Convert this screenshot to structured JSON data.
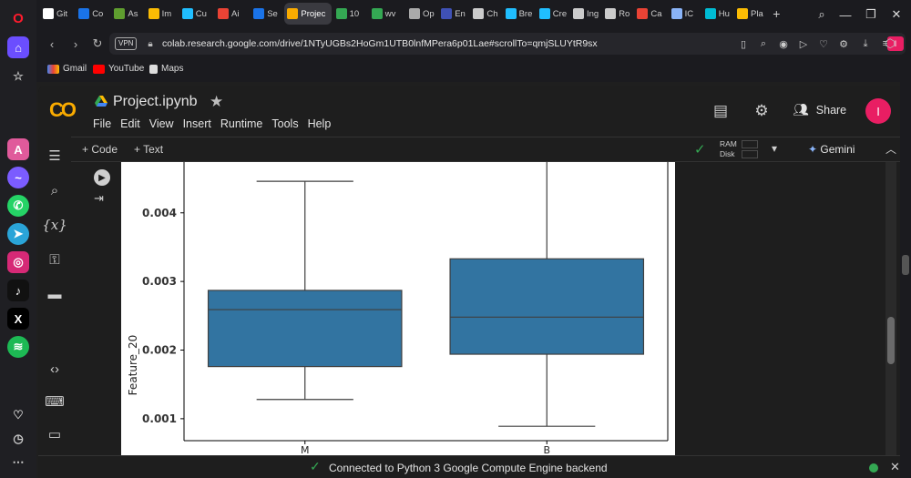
{
  "browser": {
    "tabs": [
      {
        "label": "Git",
        "icon": "github-icon",
        "color": "#ffffff"
      },
      {
        "label": "Co",
        "icon": "colab-icon",
        "color": "#1a73e8"
      },
      {
        "label": "As",
        "icon": "image-icon",
        "color": "#5f9e2f"
      },
      {
        "label": "Im",
        "icon": "drive-icon",
        "color": "#fbbc04"
      },
      {
        "label": "Cu",
        "icon": "kaggle-icon",
        "color": "#20beff"
      },
      {
        "label": "Ai",
        "icon": "gmail-icon",
        "color": "#ea4335"
      },
      {
        "label": "Se",
        "icon": "colab-icon",
        "color": "#1a73e8"
      },
      {
        "label": "Projec",
        "icon": "colab-icon",
        "color": "#f9ab00"
      },
      {
        "label": "10",
        "icon": "infinity-icon",
        "color": "#34a853"
      },
      {
        "label": "wv",
        "icon": "infinity-icon",
        "color": "#34a853"
      },
      {
        "label": "Op",
        "icon": "moon-icon",
        "color": "#aaaaaa"
      },
      {
        "label": "En",
        "icon": "wo-icon",
        "color": "#3f51b5"
      },
      {
        "label": "Ch",
        "icon": "openai-icon",
        "color": "#cccccc"
      },
      {
        "label": "Bre",
        "icon": "kaggle-icon",
        "color": "#20beff"
      },
      {
        "label": "Cre",
        "icon": "kaggle-icon",
        "color": "#20beff"
      },
      {
        "label": "Ing",
        "icon": "chart-icon",
        "color": "#cccccc"
      },
      {
        "label": "Ro",
        "icon": "globe-icon",
        "color": "#cccccc"
      },
      {
        "label": "Ca",
        "icon": "gmail-icon",
        "color": "#ea4335"
      },
      {
        "label": "IC",
        "icon": "tag-icon",
        "color": "#8ab4f8"
      },
      {
        "label": "Hu",
        "icon": "hf-icon",
        "color": "#00bcd4"
      },
      {
        "label": "Pla",
        "icon": "search-icon",
        "color": "#fbbc04"
      }
    ],
    "vpn_label": "VPN",
    "url": "colab.research.google.com/drive/1NTyUGBs2HoGm1UTB0lnfMPera6p01Lae#scrollTo=qmjSLUYtR9sx",
    "profile_initial": "I",
    "bookmarks": [
      {
        "label": "Gmail",
        "icon": "gmail-icon"
      },
      {
        "label": "YouTube",
        "icon": "youtube-icon"
      },
      {
        "label": "Maps",
        "icon": "file-icon"
      }
    ]
  },
  "colab": {
    "logo": "CO",
    "title": "Project.ipynb",
    "menu": [
      "File",
      "Edit",
      "View",
      "Insert",
      "Runtime",
      "Tools",
      "Help"
    ],
    "share_label": "Share",
    "user_initial": "I",
    "add_code": "+ Code",
    "add_text": "+ Text",
    "ram_label": "RAM",
    "disk_label": "Disk",
    "gemini_label": "Gemini",
    "status": "Connected to Python 3 Google Compute Engine backend"
  },
  "chart_data": {
    "type": "box",
    "categories": [
      "M",
      "B"
    ],
    "ylabel": "Feature_20",
    "xlabel": "",
    "yticks": [
      0.001,
      0.002,
      0.003,
      0.004
    ],
    "ylim": [
      0.00068,
      0.00474
    ],
    "boxes": [
      {
        "name": "M",
        "whisker_low": 0.00128,
        "q1": 0.00176,
        "median": 0.00259,
        "q3": 0.00287,
        "whisker_high": 0.00446
      },
      {
        "name": "B",
        "whisker_low": 0.00089,
        "q1": 0.00194,
        "median": 0.00248,
        "q3": 0.00333,
        "whisker_high": 0.0048
      }
    ],
    "box_color": "#3274a1"
  }
}
